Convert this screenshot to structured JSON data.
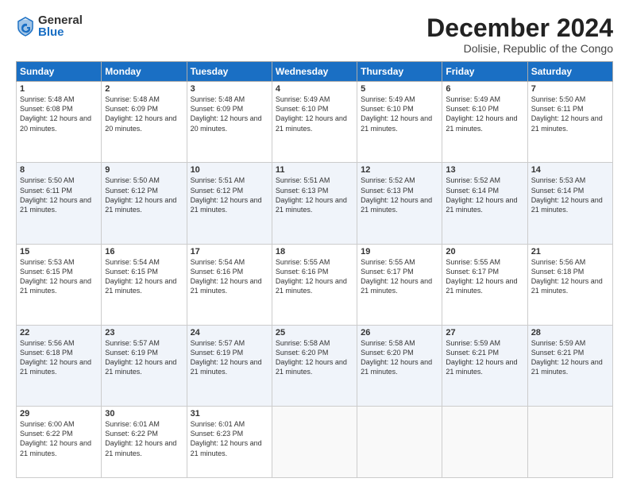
{
  "logo": {
    "general": "General",
    "blue": "Blue"
  },
  "title": "December 2024",
  "subtitle": "Dolisie, Republic of the Congo",
  "days_of_week": [
    "Sunday",
    "Monday",
    "Tuesday",
    "Wednesday",
    "Thursday",
    "Friday",
    "Saturday"
  ],
  "weeks": [
    [
      {
        "day": "1",
        "sunrise": "5:48 AM",
        "sunset": "6:08 PM",
        "daylight": "12 hours and 20 minutes."
      },
      {
        "day": "2",
        "sunrise": "5:48 AM",
        "sunset": "6:09 PM",
        "daylight": "12 hours and 20 minutes."
      },
      {
        "day": "3",
        "sunrise": "5:48 AM",
        "sunset": "6:09 PM",
        "daylight": "12 hours and 20 minutes."
      },
      {
        "day": "4",
        "sunrise": "5:49 AM",
        "sunset": "6:10 PM",
        "daylight": "12 hours and 21 minutes."
      },
      {
        "day": "5",
        "sunrise": "5:49 AM",
        "sunset": "6:10 PM",
        "daylight": "12 hours and 21 minutes."
      },
      {
        "day": "6",
        "sunrise": "5:49 AM",
        "sunset": "6:10 PM",
        "daylight": "12 hours and 21 minutes."
      },
      {
        "day": "7",
        "sunrise": "5:50 AM",
        "sunset": "6:11 PM",
        "daylight": "12 hours and 21 minutes."
      }
    ],
    [
      {
        "day": "8",
        "sunrise": "5:50 AM",
        "sunset": "6:11 PM",
        "daylight": "12 hours and 21 minutes."
      },
      {
        "day": "9",
        "sunrise": "5:50 AM",
        "sunset": "6:12 PM",
        "daylight": "12 hours and 21 minutes."
      },
      {
        "day": "10",
        "sunrise": "5:51 AM",
        "sunset": "6:12 PM",
        "daylight": "12 hours and 21 minutes."
      },
      {
        "day": "11",
        "sunrise": "5:51 AM",
        "sunset": "6:13 PM",
        "daylight": "12 hours and 21 minutes."
      },
      {
        "day": "12",
        "sunrise": "5:52 AM",
        "sunset": "6:13 PM",
        "daylight": "12 hours and 21 minutes."
      },
      {
        "day": "13",
        "sunrise": "5:52 AM",
        "sunset": "6:14 PM",
        "daylight": "12 hours and 21 minutes."
      },
      {
        "day": "14",
        "sunrise": "5:53 AM",
        "sunset": "6:14 PM",
        "daylight": "12 hours and 21 minutes."
      }
    ],
    [
      {
        "day": "15",
        "sunrise": "5:53 AM",
        "sunset": "6:15 PM",
        "daylight": "12 hours and 21 minutes."
      },
      {
        "day": "16",
        "sunrise": "5:54 AM",
        "sunset": "6:15 PM",
        "daylight": "12 hours and 21 minutes."
      },
      {
        "day": "17",
        "sunrise": "5:54 AM",
        "sunset": "6:16 PM",
        "daylight": "12 hours and 21 minutes."
      },
      {
        "day": "18",
        "sunrise": "5:55 AM",
        "sunset": "6:16 PM",
        "daylight": "12 hours and 21 minutes."
      },
      {
        "day": "19",
        "sunrise": "5:55 AM",
        "sunset": "6:17 PM",
        "daylight": "12 hours and 21 minutes."
      },
      {
        "day": "20",
        "sunrise": "5:55 AM",
        "sunset": "6:17 PM",
        "daylight": "12 hours and 21 minutes."
      },
      {
        "day": "21",
        "sunrise": "5:56 AM",
        "sunset": "6:18 PM",
        "daylight": "12 hours and 21 minutes."
      }
    ],
    [
      {
        "day": "22",
        "sunrise": "5:56 AM",
        "sunset": "6:18 PM",
        "daylight": "12 hours and 21 minutes."
      },
      {
        "day": "23",
        "sunrise": "5:57 AM",
        "sunset": "6:19 PM",
        "daylight": "12 hours and 21 minutes."
      },
      {
        "day": "24",
        "sunrise": "5:57 AM",
        "sunset": "6:19 PM",
        "daylight": "12 hours and 21 minutes."
      },
      {
        "day": "25",
        "sunrise": "5:58 AM",
        "sunset": "6:20 PM",
        "daylight": "12 hours and 21 minutes."
      },
      {
        "day": "26",
        "sunrise": "5:58 AM",
        "sunset": "6:20 PM",
        "daylight": "12 hours and 21 minutes."
      },
      {
        "day": "27",
        "sunrise": "5:59 AM",
        "sunset": "6:21 PM",
        "daylight": "12 hours and 21 minutes."
      },
      {
        "day": "28",
        "sunrise": "5:59 AM",
        "sunset": "6:21 PM",
        "daylight": "12 hours and 21 minutes."
      }
    ],
    [
      {
        "day": "29",
        "sunrise": "6:00 AM",
        "sunset": "6:22 PM",
        "daylight": "12 hours and 21 minutes."
      },
      {
        "day": "30",
        "sunrise": "6:01 AM",
        "sunset": "6:22 PM",
        "daylight": "12 hours and 21 minutes."
      },
      {
        "day": "31",
        "sunrise": "6:01 AM",
        "sunset": "6:23 PM",
        "daylight": "12 hours and 21 minutes."
      },
      null,
      null,
      null,
      null
    ]
  ]
}
